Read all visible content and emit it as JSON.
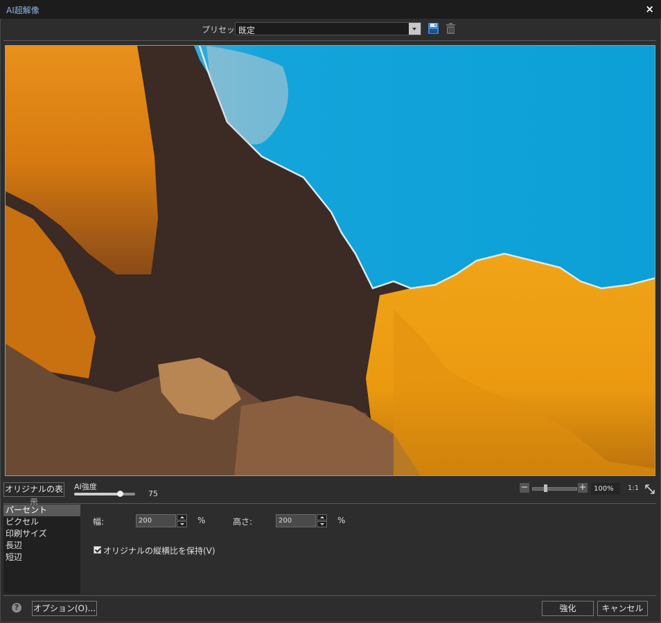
{
  "window": {
    "title": "AI超解像",
    "close": "×"
  },
  "preset": {
    "label": "プリセット",
    "value": "既定"
  },
  "controls": {
    "show_original": "オリジナルの表示",
    "ai_strength_label": "AI強度",
    "ai_strength_value": "75",
    "ai_strength": 75,
    "ai_strength_max": 100,
    "zoom_value": "100%",
    "zoom_one_to_one": "1:1",
    "zoom_minus": "−",
    "zoom_plus": "+",
    "zoom_level": 0.28
  },
  "modes": [
    "パーセント",
    "ピクセル",
    "印刷サイズ",
    "長辺",
    "短辺"
  ],
  "selected_mode": "パーセント",
  "size": {
    "width_label": "幅:",
    "width_value": "200",
    "width_unit": "%",
    "height_label": "高さ:",
    "height_value": "200",
    "height_unit": "%",
    "keep_aspect_label": "オリジナルの縦横比を保持(V)",
    "keep_aspect": true
  },
  "footer": {
    "help": "?",
    "options": "オプション(O)...",
    "enhance": "強化",
    "cancel": "キャンセル"
  },
  "colors": {
    "accent": "#8fb5e3",
    "sky": "#0ea3d8",
    "rock_bright": "#f2a012",
    "rock_dark": "#3d2b24"
  }
}
